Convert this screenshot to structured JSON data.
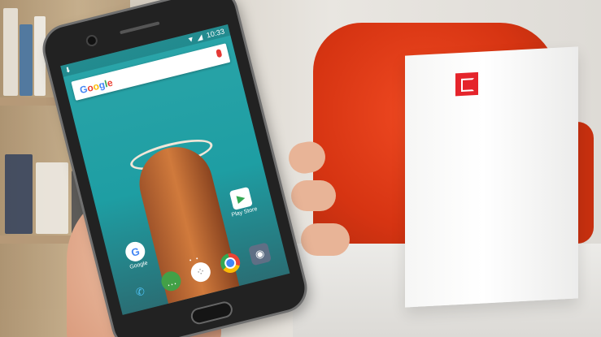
{
  "search_widget": {
    "logo_text": "Google"
  },
  "status_bar": {
    "time": "10:33"
  },
  "home_apps": [
    {
      "label": "Google",
      "icon": "google-g-icon"
    },
    {
      "label": "Play Store",
      "icon": "play-store-icon"
    }
  ],
  "dock_apps": [
    {
      "icon": "phone-icon"
    },
    {
      "icon": "messages-icon"
    },
    {
      "icon": "app-drawer-icon"
    },
    {
      "icon": "chrome-icon"
    },
    {
      "icon": "camera-icon"
    }
  ],
  "colors": {
    "oneplus_red": "#e5242b",
    "chair_red": "#d63412",
    "screen_teal": "#1e9ea3"
  }
}
